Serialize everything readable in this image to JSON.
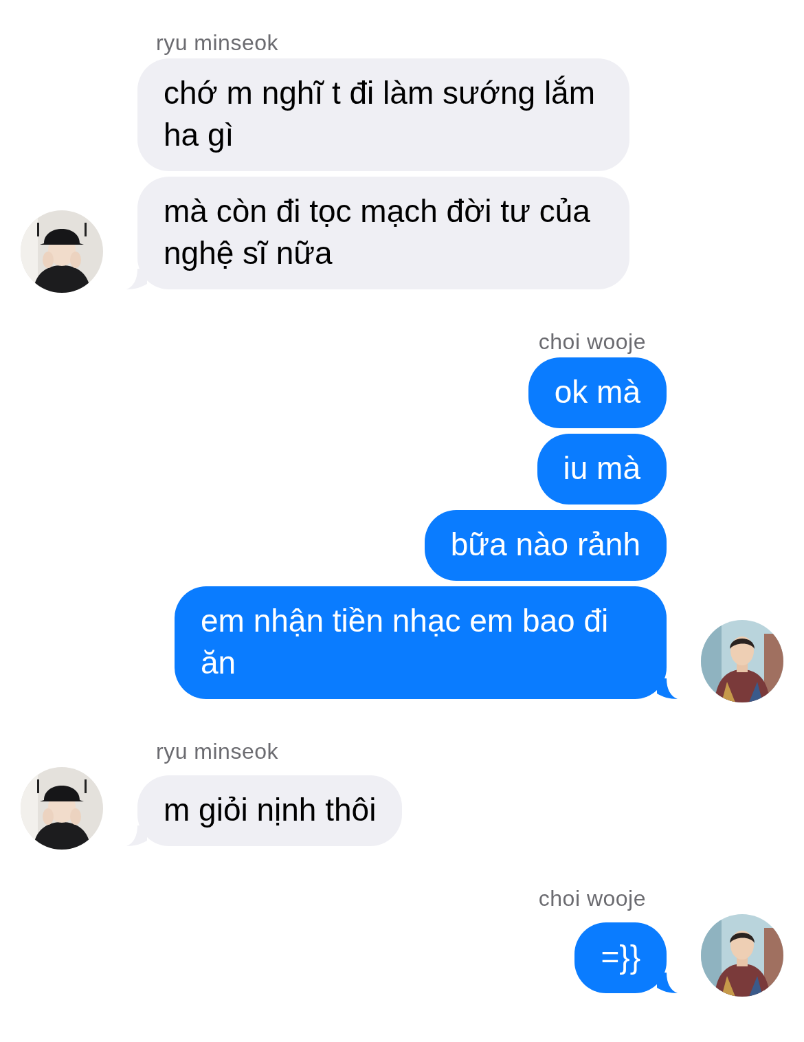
{
  "groups": [
    {
      "sender": "ryu minseok",
      "kind": "incoming",
      "avatar": {
        "kind": "picture"
      },
      "bubbles": [
        "chớ m nghĩ t đi làm sướng lắm ha gì",
        "mà còn đi tọc mạch đời tư của nghệ sĩ nữa"
      ]
    },
    {
      "sender": "choi wooje",
      "kind": "outgoing",
      "avatar": {
        "kind": "picture"
      },
      "bubbles": [
        "ok mà",
        "iu mà",
        "bữa nào rảnh",
        "em nhận tiền nhạc em bao đi ăn"
      ]
    },
    {
      "sender": "ryu minseok",
      "kind": "incoming",
      "avatar": {
        "kind": "picture"
      },
      "bubbles": [
        "m giỏi nịnh thôi"
      ]
    },
    {
      "sender": "choi wooje",
      "kind": "outgoing",
      "avatar": {
        "kind": "picture"
      },
      "bubbles": [
        "=}}"
      ]
    }
  ]
}
